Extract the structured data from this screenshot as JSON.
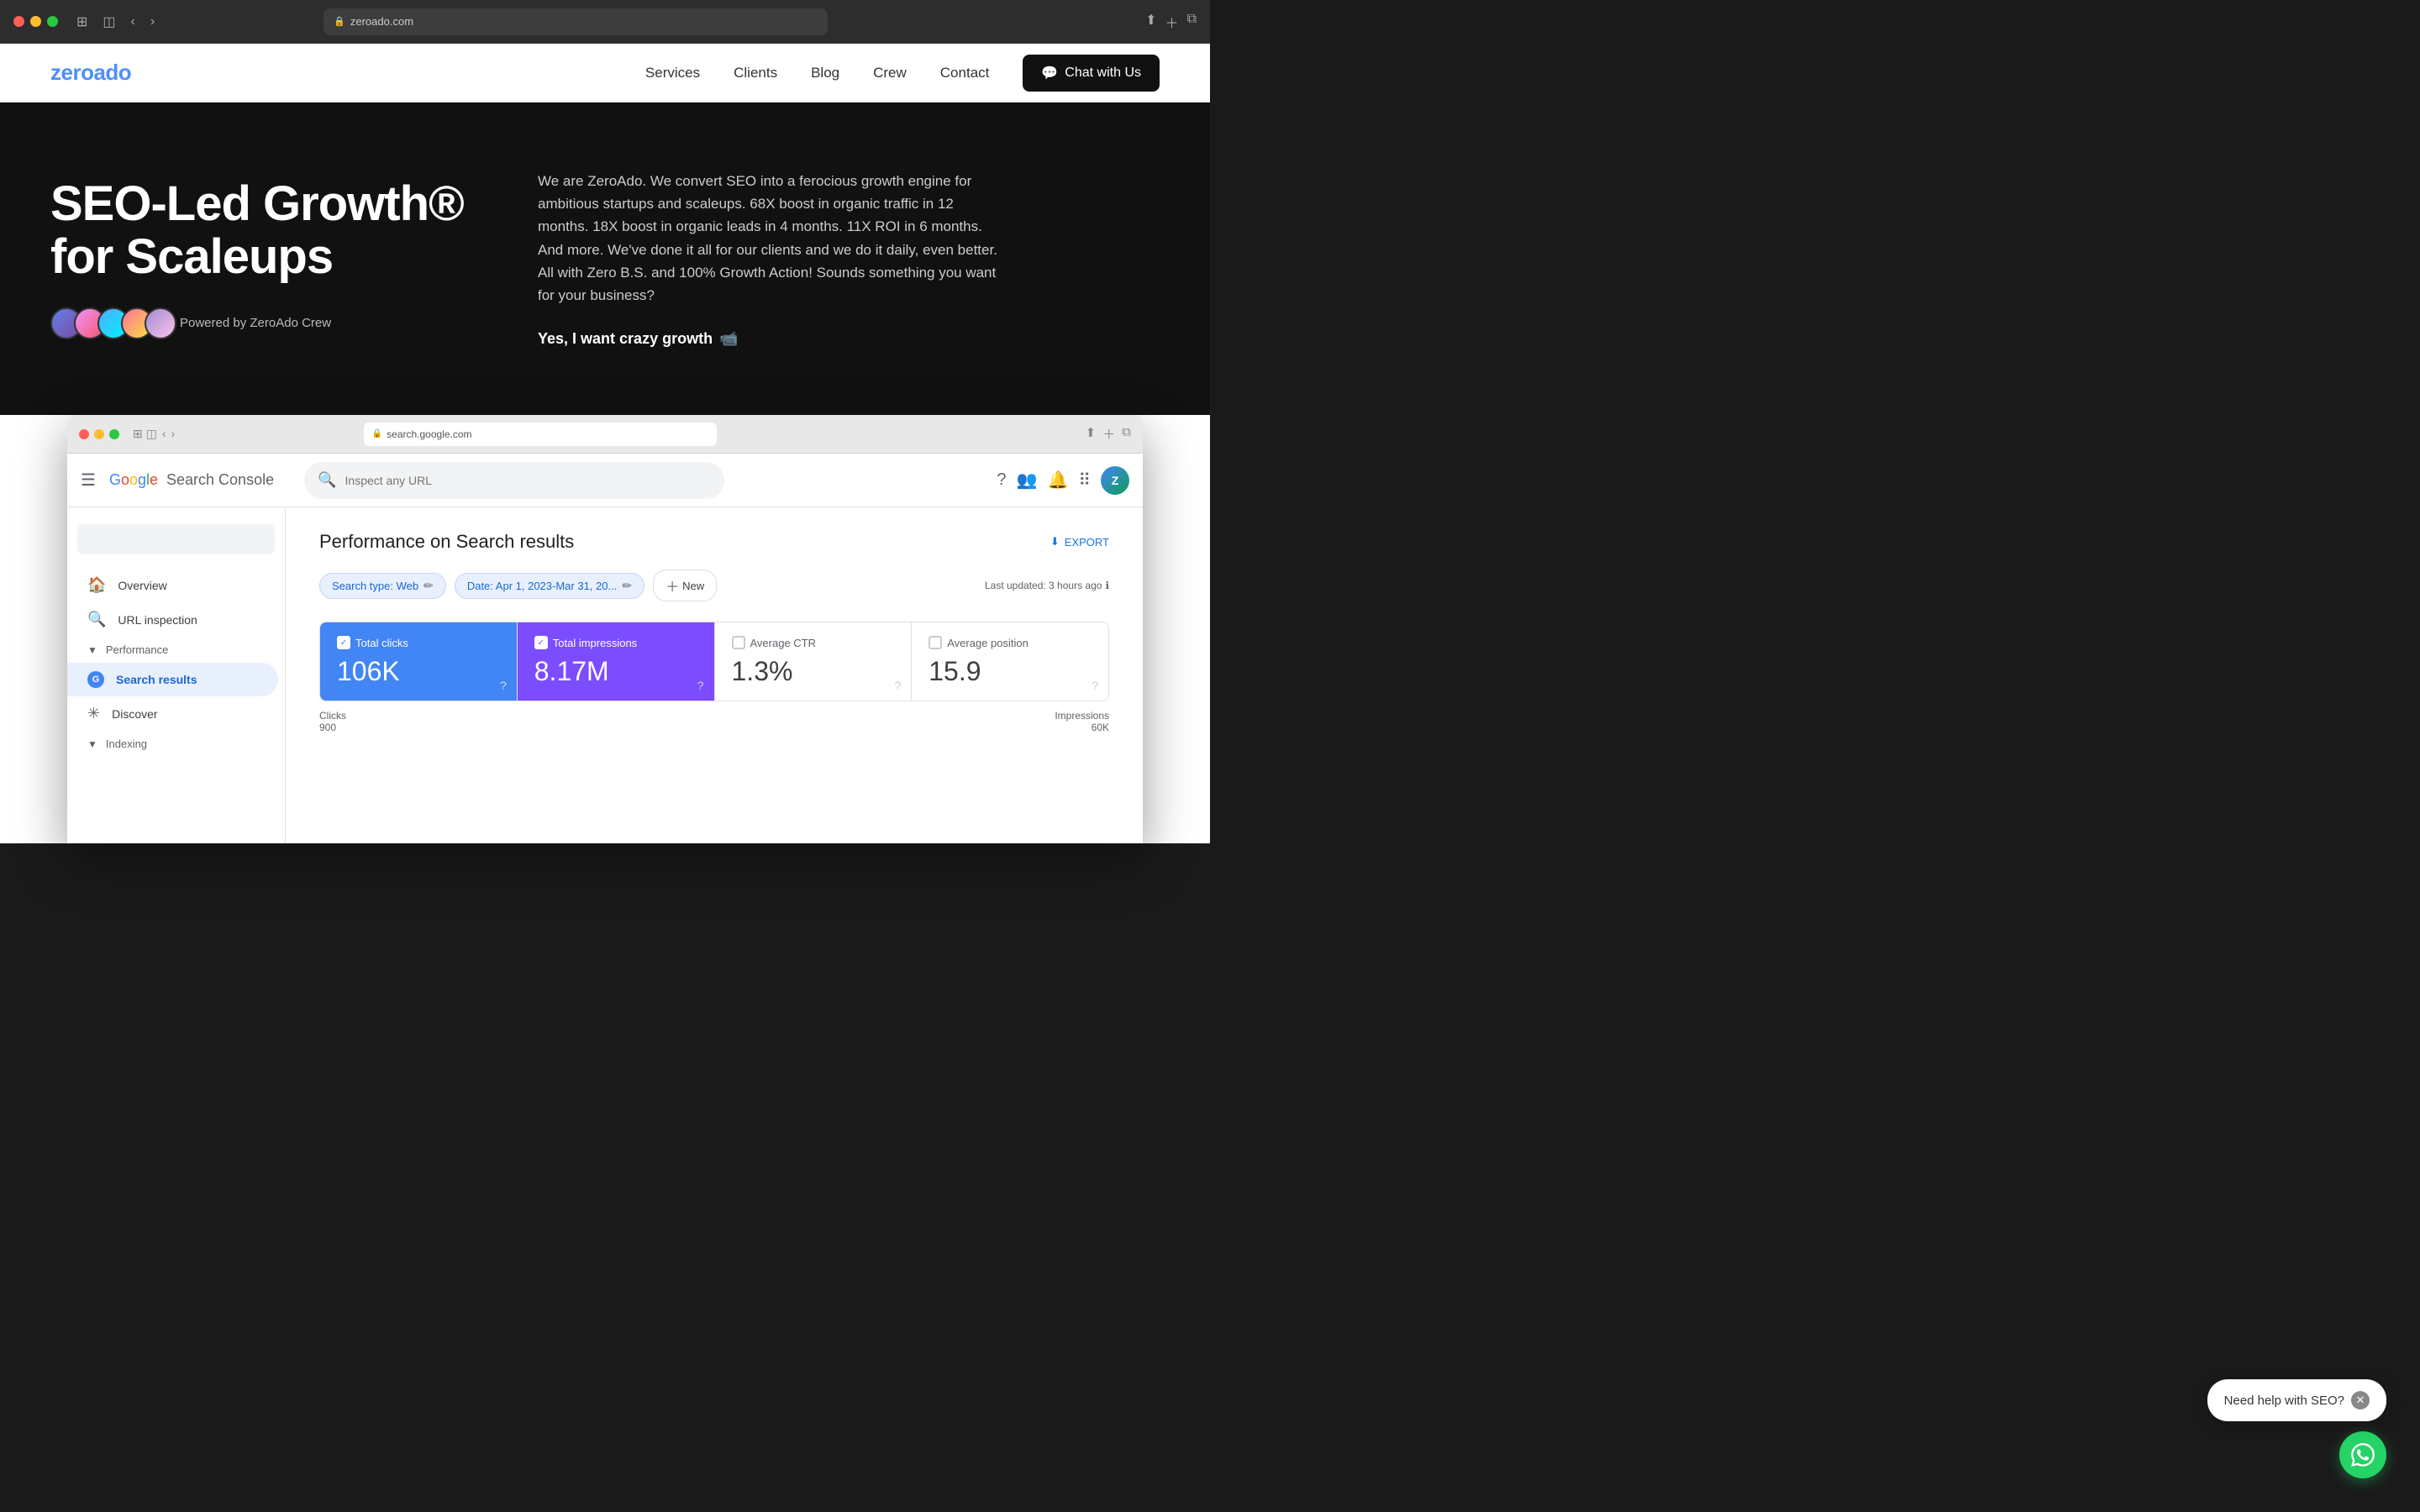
{
  "browser": {
    "url": "zeroado.com",
    "nav_back": "‹",
    "nav_forward": "›",
    "tab_icon": "⊞"
  },
  "nav": {
    "logo_zero": "zero",
    "logo_ado": "ado",
    "links": [
      "Services",
      "Clients",
      "Blog",
      "Crew",
      "Contact"
    ],
    "cta_label": "Chat with Us",
    "cta_icon": "💬"
  },
  "hero": {
    "title_line1": "SEO-Led Growth®",
    "title_line2": "for Scaleups",
    "powered_by": "Powered by ZeroAdo Crew",
    "description": "We are ZeroAdo. We convert SEO into a ferocious growth engine for ambitious startups and scaleups. 68X boost in organic traffic in 12 months. 18X boost in organic leads in 4 months. 11X ROI in 6 months. And more. We've done it all for our clients and we do it daily, even better. All with Zero B.S. and 100% Growth Action! Sounds something you want for your business?",
    "cta_text": "Yes, I want crazy growth",
    "cta_emoji": "📹"
  },
  "inner_browser": {
    "url": "search.google.com"
  },
  "gsc": {
    "search_placeholder": "Inspect any URL",
    "logo_google": "Google",
    "logo_product": "Search Console",
    "page_title": "Performance on Search results",
    "export_label": "EXPORT",
    "filter_search_type": "Search type: Web",
    "filter_date": "Date: Apr 1, 2023-Mar 31, 20...",
    "new_label": "New",
    "last_updated": "Last updated: 3 hours ago",
    "sidebar": {
      "overview": "Overview",
      "url_inspection": "URL inspection",
      "performance_header": "Performance",
      "search_results": "Search results",
      "discover": "Discover",
      "indexing_header": "Indexing"
    },
    "metrics": [
      {
        "id": "total_clicks",
        "label": "Total clicks",
        "value": "106K",
        "state": "active-blue",
        "checked": true
      },
      {
        "id": "total_impressions",
        "label": "Total impressions",
        "value": "8.17M",
        "state": "active-purple",
        "checked": true
      },
      {
        "id": "average_ctr",
        "label": "Average CTR",
        "value": "1.3%",
        "state": "inactive",
        "checked": false
      },
      {
        "id": "average_position",
        "label": "Average position",
        "value": "15.9",
        "state": "inactive",
        "checked": false
      }
    ],
    "stats": {
      "clicks_label": "Clicks",
      "clicks_value": "900",
      "impressions_label": "Impressions",
      "impressions_value": "60K"
    }
  },
  "chat_widget": {
    "bubble_text": "Need help with SEO?",
    "whatsapp_icon": "✓"
  }
}
